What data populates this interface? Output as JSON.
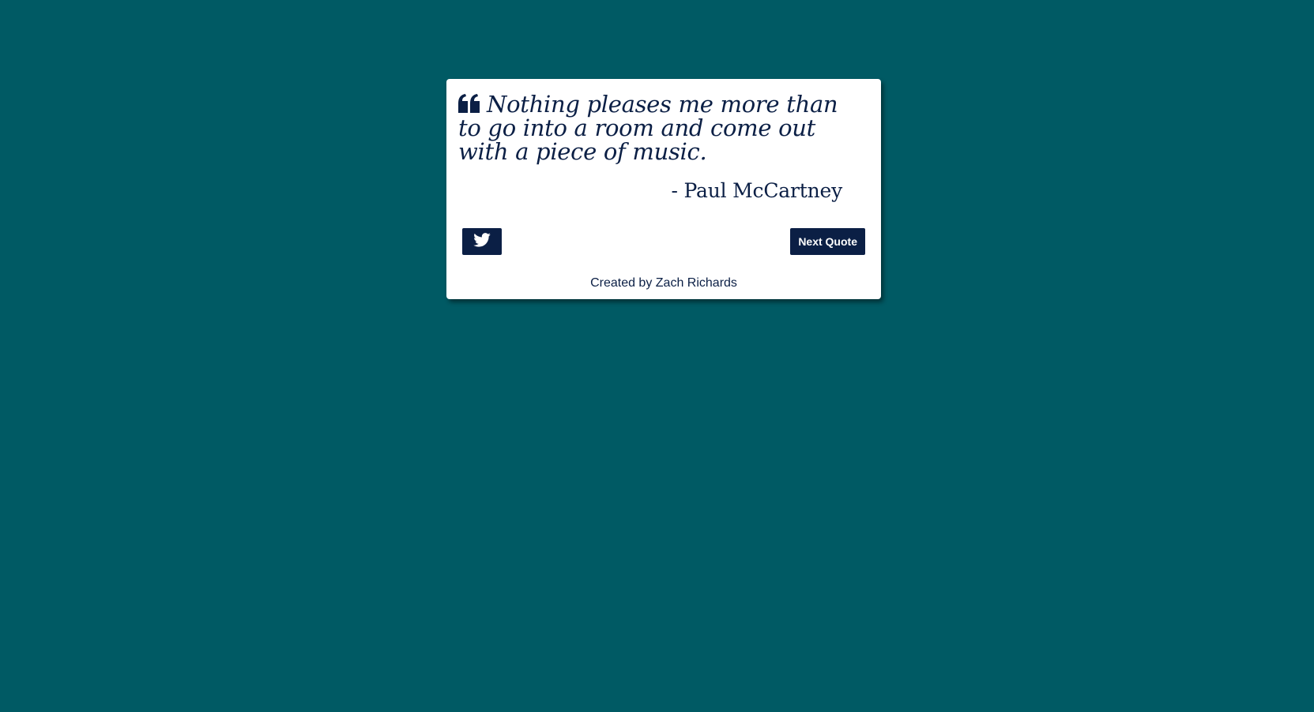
{
  "quote": {
    "text": "Nothing pleases me more than to go into a room and come out with a piece of music.",
    "author": "- Paul McCartney",
    "icon": "quote-left-icon"
  },
  "actions": {
    "tweet_icon": "twitter-icon",
    "next_label": "Next Quote"
  },
  "footer": {
    "credit": "Created by Zach Richards"
  },
  "colors": {
    "background": "#005a64",
    "card": "#ffffff",
    "accent": "#0b1f45"
  }
}
